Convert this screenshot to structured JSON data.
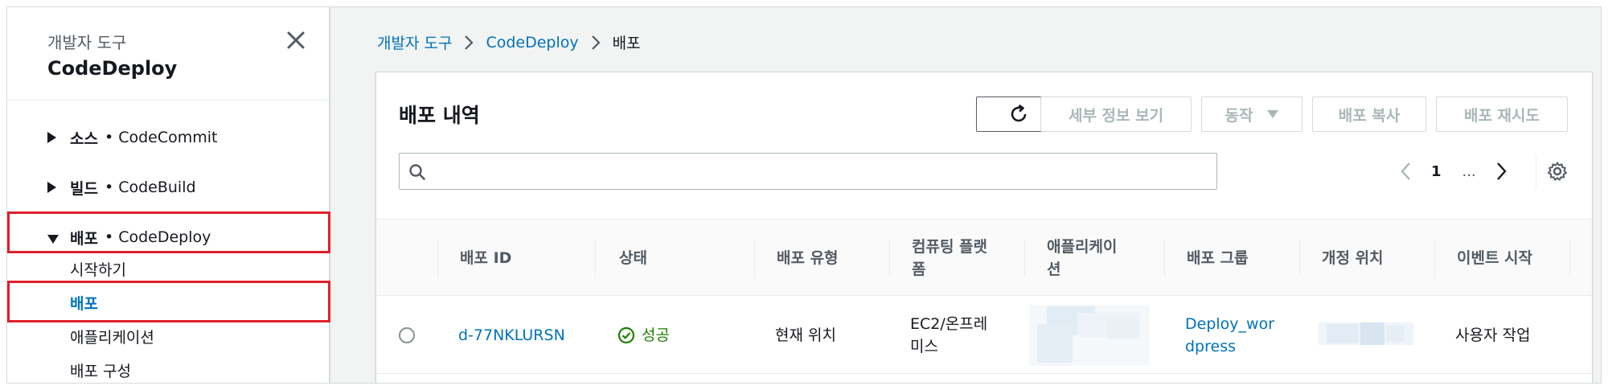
{
  "sidebar": {
    "subtitle": "개발자 도구",
    "title": "CodeDeploy",
    "sections": [
      {
        "name": "소스",
        "service": "• CodeCommit",
        "expanded": false
      },
      {
        "name": "빌드",
        "service": "• CodeBuild",
        "expanded": false
      },
      {
        "name": "배포",
        "service": "• CodeDeploy",
        "expanded": true
      }
    ],
    "items": [
      {
        "label": "시작하기",
        "active": false
      },
      {
        "label": "배포",
        "active": true
      },
      {
        "label": "애플리케이션",
        "active": false
      },
      {
        "label": "배포 구성",
        "active": false
      }
    ]
  },
  "breadcrumb": {
    "items": [
      "개발자 도구",
      "CodeDeploy"
    ],
    "current": "배포"
  },
  "panel": {
    "title": "배포 내역",
    "buttons": {
      "details": "세부 정보 보기",
      "actions": "동작",
      "copy": "배포 복사",
      "retry": "배포 재시도"
    },
    "search": {
      "value": "",
      "placeholder": ""
    },
    "pagination": {
      "current": "1",
      "ellipsis": "..."
    }
  },
  "table": {
    "columns": [
      "배포 ID",
      "상태",
      "배포 유형",
      "컴퓨팅 플랫폼",
      "애플리케이션",
      "배포 그룹",
      "개정 위치",
      "이벤트 시작"
    ],
    "columns_wrapped": {
      "platform": [
        "컴퓨팅 플랫",
        "폼"
      ],
      "application": [
        "애플리케이",
        "션"
      ]
    },
    "rows": [
      {
        "id": "d-77NKLURSN",
        "status": "성공",
        "type": "현재 위치",
        "platform_lines": [
          "EC2/온프레",
          "미스"
        ],
        "group_lines": [
          "Deploy_wor",
          "dpress"
        ],
        "event": "사용자 작업"
      }
    ]
  },
  "colors": {
    "link": "#0073bb",
    "success": "#1d8102",
    "highlight": "#e0202a",
    "disabled": "#aab7b8"
  }
}
